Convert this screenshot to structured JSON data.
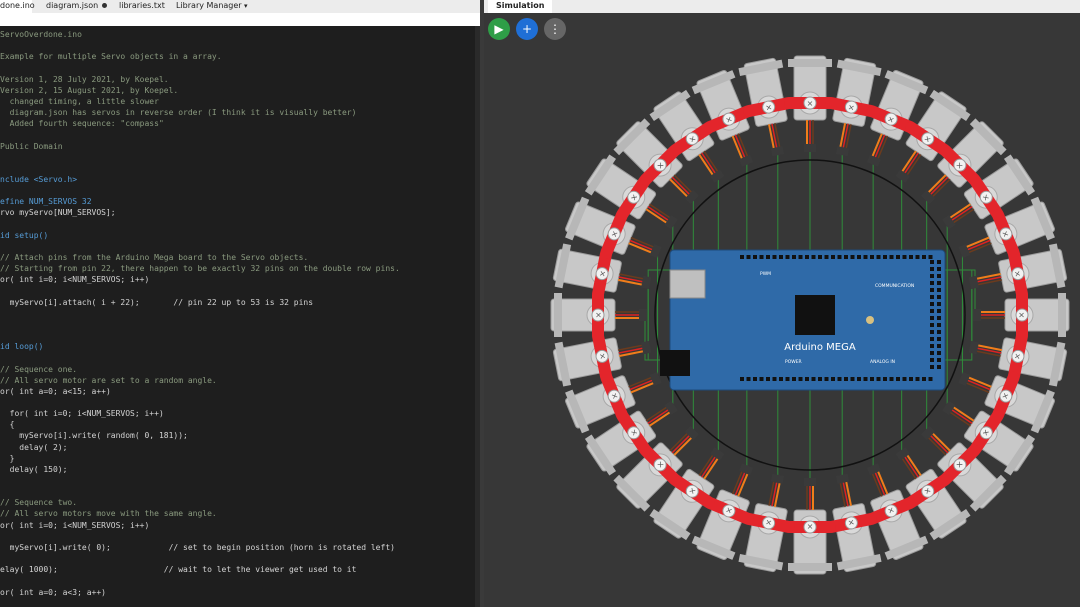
{
  "editor": {
    "tabs": [
      {
        "label": "done.ino",
        "active": true,
        "modified": false
      },
      {
        "label": "diagram.json",
        "active": false,
        "modified": true
      },
      {
        "label": "libraries.txt",
        "active": false,
        "modified": false
      },
      {
        "label": "Library Manager",
        "active": false,
        "modified": false,
        "menu_icon": "chevron-down-icon"
      }
    ],
    "code_lines": [
      {
        "text": "ServoOverdone.ino",
        "cls": "cmt"
      },
      {
        "text": "",
        "cls": ""
      },
      {
        "text": "Example for multiple Servo objects in a array.",
        "cls": "cmt"
      },
      {
        "text": "",
        "cls": ""
      },
      {
        "text": "Version 1, 28 July 2021, by Koepel.",
        "cls": "cmt"
      },
      {
        "text": "Version 2, 15 August 2021, by Koepel.",
        "cls": "cmt"
      },
      {
        "text": "  changed timing, a little slower",
        "cls": "cmt"
      },
      {
        "text": "  diagram.json has servos in reverse order (I think it is visually better)",
        "cls": "cmt"
      },
      {
        "text": "  Added fourth sequence: \"compass\"",
        "cls": "cmt"
      },
      {
        "text": "",
        "cls": ""
      },
      {
        "text": "Public Domain",
        "cls": "cmt"
      },
      {
        "text": "",
        "cls": ""
      },
      {
        "text": "",
        "cls": ""
      },
      {
        "text": "nclude <Servo.h>",
        "cls": "kw"
      },
      {
        "text": "",
        "cls": ""
      },
      {
        "text": "efine NUM_SERVOS 32",
        "cls": "kw"
      },
      {
        "text": "rvo myServo[NUM_SERVOS];",
        "cls": ""
      },
      {
        "text": "",
        "cls": ""
      },
      {
        "text": "id setup()",
        "cls": "kw"
      },
      {
        "text": "",
        "cls": ""
      },
      {
        "text": "// Attach pins from the Arduino Mega board to the Servo objects.",
        "cls": "cmt"
      },
      {
        "text": "// Starting from pin 22, there happen to be exactly 32 pins on the double row pins.",
        "cls": "cmt"
      },
      {
        "text": "or( int i=0; i<NUM_SERVOS; i++)",
        "cls": ""
      },
      {
        "text": "",
        "cls": ""
      },
      {
        "text": "  myServo[i].attach( i + 22);       // pin 22 up to 53 is 32 pins",
        "cls": ""
      },
      {
        "text": "",
        "cls": ""
      },
      {
        "text": "",
        "cls": ""
      },
      {
        "text": "",
        "cls": ""
      },
      {
        "text": "id loop()",
        "cls": "kw"
      },
      {
        "text": "",
        "cls": ""
      },
      {
        "text": "// Sequence one.",
        "cls": "cmt"
      },
      {
        "text": "// All servo motor are set to a random angle.",
        "cls": "cmt"
      },
      {
        "text": "or( int a=0; a<15; a++)",
        "cls": ""
      },
      {
        "text": "",
        "cls": ""
      },
      {
        "text": "  for( int i=0; i<NUM_SERVOS; i++)",
        "cls": ""
      },
      {
        "text": "  {",
        "cls": ""
      },
      {
        "text": "    myServo[i].write( random( 0, 181));",
        "cls": ""
      },
      {
        "text": "    delay( 2);",
        "cls": ""
      },
      {
        "text": "  }",
        "cls": ""
      },
      {
        "text": "  delay( 150);",
        "cls": ""
      },
      {
        "text": "",
        "cls": ""
      },
      {
        "text": "",
        "cls": ""
      },
      {
        "text": "// Sequence two.",
        "cls": "cmt"
      },
      {
        "text": "// All servo motors move with the same angle.",
        "cls": "cmt"
      },
      {
        "text": "or( int i=0; i<NUM_SERVOS; i++)",
        "cls": ""
      },
      {
        "text": "",
        "cls": ""
      },
      {
        "text": "  myServo[i].write( 0);            // set to begin position (horn is rotated left)",
        "cls": ""
      },
      {
        "text": "",
        "cls": ""
      },
      {
        "text": "elay( 1000);                      // wait to let the viewer get used to it",
        "cls": ""
      },
      {
        "text": "",
        "cls": ""
      },
      {
        "text": "or( int a=0; a<3; a++)",
        "cls": ""
      }
    ]
  },
  "simulation": {
    "tab_label": "Simulation",
    "buttons": [
      {
        "name": "play-button",
        "icon": "play-icon",
        "glyph": "▶",
        "color": "#2e9e47"
      },
      {
        "name": "add-part-button",
        "icon": "plus-icon",
        "glyph": "+",
        "color": "#1f6fd6"
      },
      {
        "name": "more-options-button",
        "icon": "more-vertical-icon",
        "glyph": "⋮",
        "color": "#666666"
      }
    ],
    "servo_count": 32,
    "board_label": "Arduino MEGA",
    "board_small_labels": [
      "PWM",
      "COMMUNICATION",
      "POWER",
      "ANALOG IN"
    ],
    "colors": {
      "background": "#373737",
      "servo_body": "#c8c8c8",
      "servo_horn": "#e3252b",
      "board": "#2f6aa8",
      "wire": "#2f8c3a"
    }
  }
}
